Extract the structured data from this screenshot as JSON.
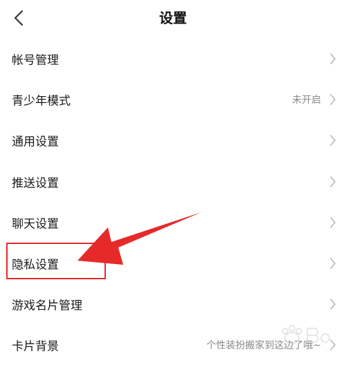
{
  "header": {
    "title": "设置",
    "back_icon": "chevron-left-icon"
  },
  "settings": {
    "items": [
      {
        "label": "帐号管理",
        "value": ""
      },
      {
        "label": "青少年模式",
        "value": "未开启"
      },
      {
        "label": "通用设置",
        "value": ""
      },
      {
        "label": "推送设置",
        "value": ""
      },
      {
        "label": "聊天设置",
        "value": ""
      },
      {
        "label": "隐私设置",
        "value": ""
      },
      {
        "label": "游戏名片管理",
        "value": ""
      },
      {
        "label": "卡片背景",
        "value": "个性装扮搬家到这边了哦~"
      }
    ]
  },
  "colors": {
    "annotation": "#e62a2a",
    "secondary_text": "#8a8a8a",
    "chevron": "#b5b5b5"
  }
}
